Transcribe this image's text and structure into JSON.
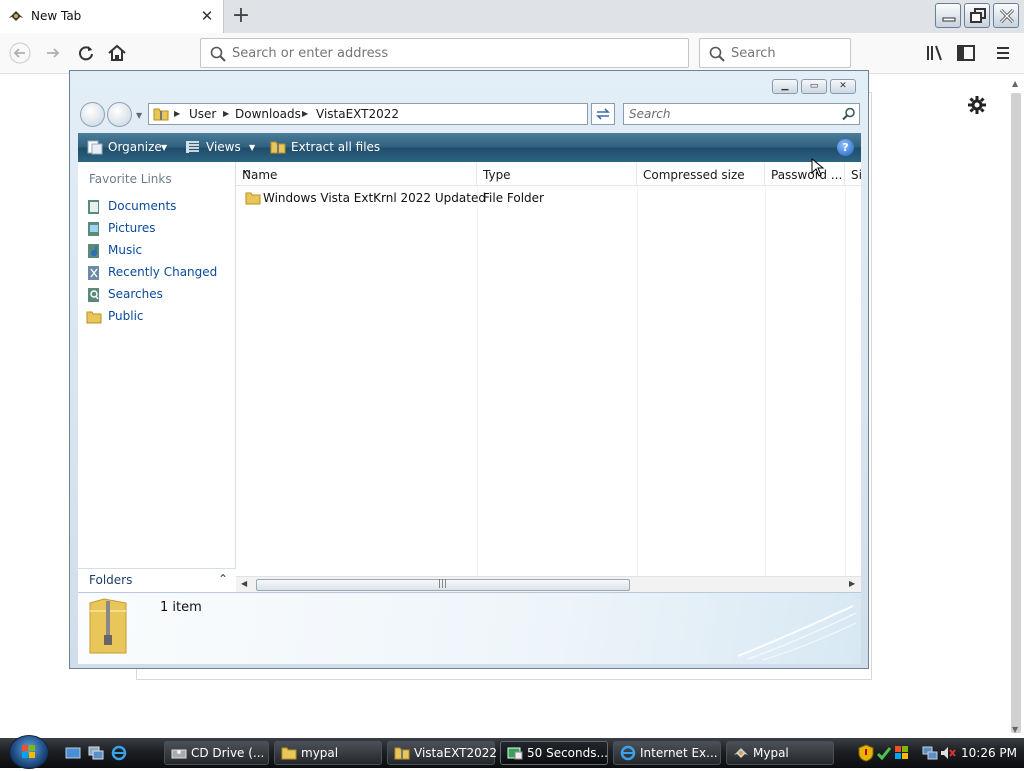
{
  "browser": {
    "tab_title": "New Tab",
    "url_placeholder": "Search or enter address",
    "search_placeholder": "Search"
  },
  "explorer": {
    "breadcrumbs": [
      "User",
      "Downloads",
      "VistaEXT2022"
    ],
    "search_placeholder": "Search",
    "commands": {
      "organize": "Organize",
      "views": "Views",
      "extract": "Extract all files"
    },
    "favorite_links_title": "Favorite Links",
    "favorite_links": [
      {
        "label": "Documents",
        "icon": "documents-icon"
      },
      {
        "label": "Pictures",
        "icon": "pictures-icon"
      },
      {
        "label": "Music",
        "icon": "music-icon"
      },
      {
        "label": "Recently Changed",
        "icon": "recently-changed-icon"
      },
      {
        "label": "Searches",
        "icon": "searches-icon"
      },
      {
        "label": "Public",
        "icon": "folder-icon"
      }
    ],
    "folders_label": "Folders",
    "columns": [
      "Name",
      "Type",
      "Compressed size",
      "Password ...",
      "Si"
    ],
    "rows": [
      {
        "name": "Windows Vista ExtKrnl 2022 Updated",
        "type": "File Folder"
      }
    ],
    "item_count": "1 item"
  },
  "taskbar": {
    "buttons": [
      {
        "label": "CD Drive (...",
        "icon": "cd-drive-icon",
        "active": false
      },
      {
        "label": "mypal",
        "icon": "folder-icon",
        "active": false
      },
      {
        "label": "VistaEXT2022",
        "icon": "zip-folder-icon",
        "active": false
      },
      {
        "label": "50 Seconds...",
        "icon": "app-icon",
        "active": true
      },
      {
        "label": "Internet Ex...",
        "icon": "internet-explorer-icon",
        "active": false
      },
      {
        "label": "Mypal",
        "icon": "mypal-icon",
        "active": false
      }
    ],
    "clock": "10:26 PM"
  },
  "colors": {
    "command_bar": "#2e5f7d",
    "link": "#0a4a9c",
    "taskbar": "#1c1f23"
  }
}
